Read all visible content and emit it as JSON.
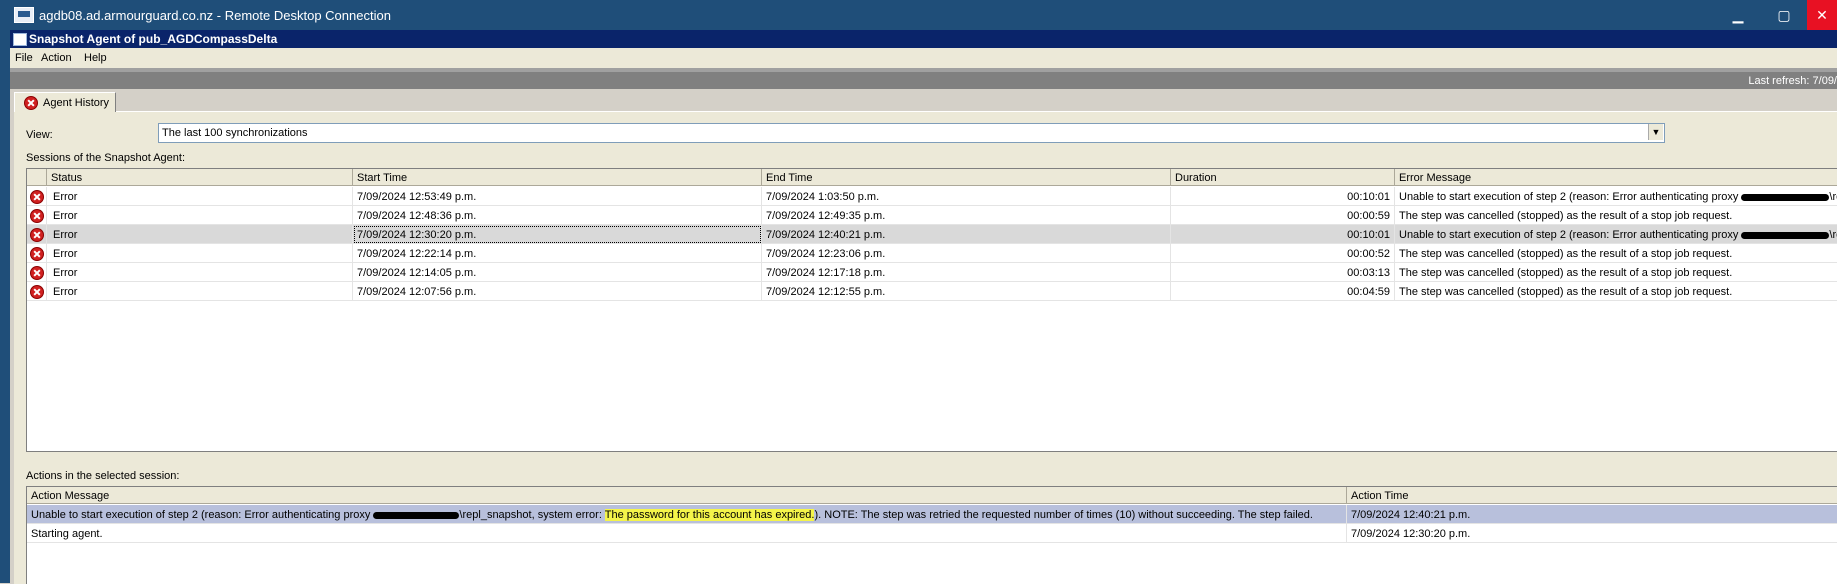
{
  "window": {
    "title": "agdb08.ad.armourguard.co.nz - Remote Desktop Connection",
    "minimize": "▁",
    "maximize": "▢",
    "close": "✕"
  },
  "app": {
    "title": "Snapshot Agent of pub_AGDCompassDelta",
    "menu": [
      "File",
      "Action",
      "Help"
    ],
    "last_refresh": "Last refresh: 7/09/"
  },
  "tab": {
    "label": "Agent History"
  },
  "view": {
    "label": "View:",
    "selected": "The last 100 synchronizations"
  },
  "sessions": {
    "label": "Sessions of the Snapshot Agent:",
    "columns": [
      "Status",
      "Start Time",
      "End Time",
      "Duration",
      "Error Message"
    ],
    "rows": [
      {
        "status": "Error",
        "start": "7/09/2024 12:53:49 p.m.",
        "end": "7/09/2024 1:03:50 p.m.",
        "duration": "00:10:01",
        "msg_pre": "Unable to start execution of step 2 (reason: Error authenticating proxy ",
        "msg_post": "\\repl_sna"
      },
      {
        "status": "Error",
        "start": "7/09/2024 12:48:36 p.m.",
        "end": "7/09/2024 12:49:35 p.m.",
        "duration": "00:00:59",
        "msg_pre": "The step was cancelled (stopped) as the result of a stop job request.",
        "msg_post": ""
      },
      {
        "status": "Error",
        "start": "7/09/2024 12:30:20 p.m.",
        "end": "7/09/2024 12:40:21 p.m.",
        "duration": "00:10:01",
        "msg_pre": "Unable to start execution of step 2 (reason: Error authenticating proxy ",
        "msg_post": "\\repl_sna"
      },
      {
        "status": "Error",
        "start": "7/09/2024 12:22:14 p.m.",
        "end": "7/09/2024 12:23:06 p.m.",
        "duration": "00:00:52",
        "msg_pre": "The step was cancelled (stopped) as the result of a stop job request.",
        "msg_post": ""
      },
      {
        "status": "Error",
        "start": "7/09/2024 12:14:05 p.m.",
        "end": "7/09/2024 12:17:18 p.m.",
        "duration": "00:03:13",
        "msg_pre": "The step was cancelled (stopped) as the result of a stop job request.",
        "msg_post": ""
      },
      {
        "status": "Error",
        "start": "7/09/2024 12:07:56 p.m.",
        "end": "7/09/2024 12:12:55 p.m.",
        "duration": "00:04:59",
        "msg_pre": "The step was cancelled (stopped) as the result of a stop job request.",
        "msg_post": ""
      }
    ]
  },
  "actions": {
    "label": "Actions in the selected session:",
    "columns": [
      "Action Message",
      "Action Time"
    ],
    "rows": [
      {
        "pre": "Unable to start execution of step 2 (reason: Error authenticating proxy ",
        "mid": "\\repl_snapshot, system error: ",
        "highlight": "The password for this account has expired.",
        "post": ").  NOTE: The step was retried the requested number of times (10) without succeeding.  The step failed.",
        "time": "7/09/2024 12:40:21 p.m."
      },
      {
        "pre": "Starting agent.",
        "mid": "",
        "highlight": "",
        "post": "",
        "time": "7/09/2024 12:30:20 p.m."
      }
    ]
  },
  "colors": {
    "rdp_bar": "#1f4e79",
    "app_bar": "#0a246a",
    "highlight": "#f4f44a"
  }
}
